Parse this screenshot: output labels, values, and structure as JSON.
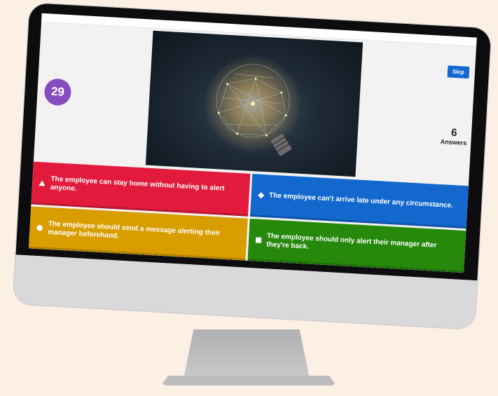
{
  "topbar": {
    "title": ""
  },
  "timer": {
    "value": "29"
  },
  "skip_button": {
    "label": "Skip"
  },
  "answers": {
    "count": "6",
    "label": "Answers"
  },
  "image": {
    "subject": "glowing light bulb with network lines"
  },
  "options": [
    {
      "shape": "triangle-icon",
      "color": "#e21b3c",
      "text": "The employee can stay home without having to alert anyone."
    },
    {
      "shape": "diamond-icon",
      "color": "#1368ce",
      "text": "The employee can't arrive late under any circumstance."
    },
    {
      "shape": "circle-icon",
      "color": "#d89e00",
      "text": "The employee should send a message alerting their manager beforehand."
    },
    {
      "shape": "square-icon",
      "color": "#26890c",
      "text": "The employee should only alert their manager after they're back."
    }
  ]
}
